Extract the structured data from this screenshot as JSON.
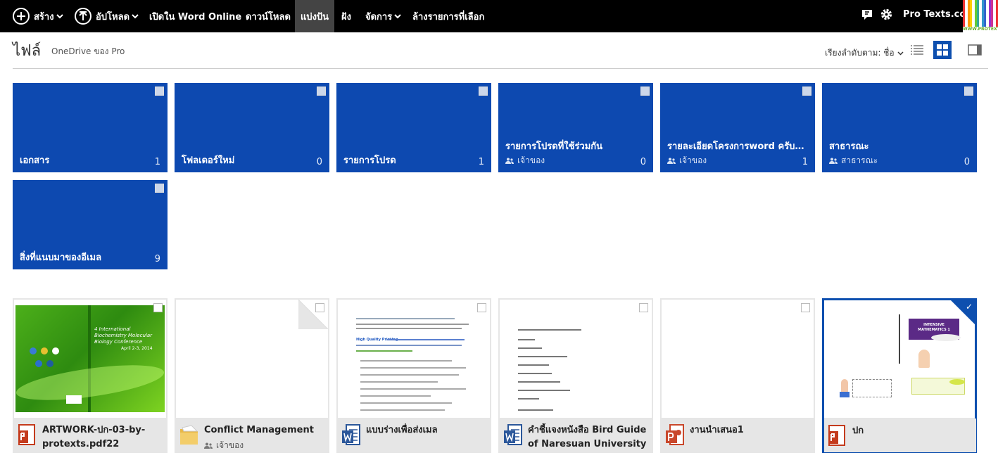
{
  "topbar": {
    "create_label": "สร้าง",
    "upload_label": "อัปโหลด",
    "open_word_label": "เปิดใน Word Online",
    "download_label": "ดาวน์โหลด",
    "share_label": "แบ่งปัน",
    "embed_label": "ฝัง",
    "manage_label": "จัดการ",
    "clear_selection_label": "ล้างรายการที่เลือก",
    "user_name": "Pro Texts.com",
    "logo_text": "WWW.PROTEXTS.COM"
  },
  "header": {
    "title": "ไฟล์",
    "breadcrumb": "OneDrive ของ Pro",
    "sort_label": "เรียงลำดับตาม: ชื่อ"
  },
  "folders": [
    {
      "name": "เอกสาร",
      "count": "1",
      "sub": ""
    },
    {
      "name": "โฟลเดอร์ใหม่",
      "count": "0",
      "sub": ""
    },
    {
      "name": "รายการโปรด",
      "count": "1",
      "sub": ""
    },
    {
      "name": "รายการโปรดที่ใช้ร่วมกัน",
      "count": "0",
      "sub": "เจ้าของ"
    },
    {
      "name": "รายละเอียดโครงการword ครับเ...",
      "count": "1",
      "sub": "เจ้าของ"
    },
    {
      "name": "สาธารณะ",
      "count": "0",
      "sub": "สาธารณะ"
    },
    {
      "name": "สิ่งที่แนบมาของอีเมล",
      "count": "9",
      "sub": ""
    }
  ],
  "files": [
    {
      "name": "ARTWORK-ปก-03-by-protexts.pdf22",
      "type": "pdf",
      "sub": "",
      "selected": false,
      "cover_title": "4 International Biochemistry Molecular Biology Conference",
      "cover_date": "April 2-3, 2014"
    },
    {
      "name": "Conflict Management",
      "type": "folder",
      "sub": "เจ้าของ",
      "selected": false
    },
    {
      "name": "แบบร่างเพื่อส่งเมล",
      "type": "word",
      "sub": "",
      "selected": false,
      "preview_heading": "High Quality Printing"
    },
    {
      "name": "คำชี้แจงหนังสือ Bird Guide of Naresuan University",
      "type": "word",
      "sub": "",
      "selected": false
    },
    {
      "name": "งานนำเสนอ1",
      "type": "powerpoint",
      "sub": "",
      "selected": false
    },
    {
      "name": "ปก",
      "type": "pdf",
      "sub": "",
      "selected": true,
      "cover_title": "INTENSIVE MATHEMATICS 1"
    }
  ],
  "colors": {
    "topbar": "#000000",
    "folder_tile": "#0d49b0",
    "accent": "#0d4faf",
    "pdf_red": "#c43b1d",
    "word_blue": "#2b579a",
    "ppt_red": "#c9472b"
  }
}
